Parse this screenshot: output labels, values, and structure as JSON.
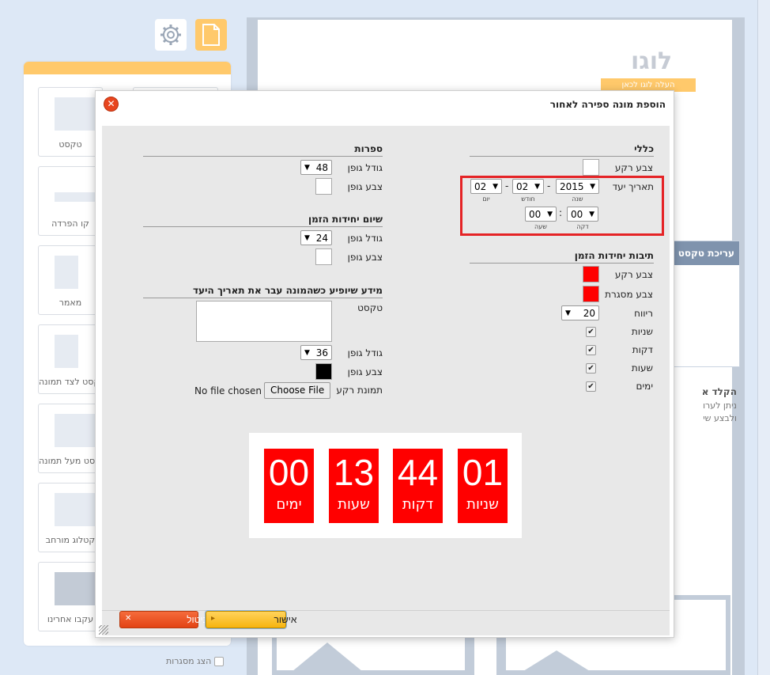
{
  "background": {
    "left_panel": {
      "widgets": [
        {
          "label": "טקסט",
          "icon": "text-widget-icon"
        },
        {
          "label": "קו הפרדה",
          "icon": "divider-widget-icon"
        },
        {
          "label": "מאמר",
          "icon": "article-widget-icon"
        },
        {
          "label": "טקסט לצד תמונה",
          "icon": "text-beside-image-icon"
        },
        {
          "label": "טקסט מעל תמונה",
          "icon": "text-above-image-icon"
        },
        {
          "label": "קטלוג מורחב",
          "icon": "catalog-icon"
        },
        {
          "label": "עקבו אחרינו",
          "icon": "social-icon"
        }
      ],
      "show_frames": "הצג מסגרות"
    },
    "canvas": {
      "logo": "לוגו",
      "logo_upload": "העלה לוגו לכאן",
      "text_edit_panel_title": "עריכת טקסט",
      "help_title": "הקלד א",
      "help_text_1": "ניתן לערו",
      "help_text_2": "ולבצע שי"
    }
  },
  "dialog": {
    "title": "הוספת מונה ספירה לאחור",
    "general": {
      "title": "כללי",
      "bg_color_label": "צבע רקע",
      "bg_color": "#ffffff",
      "target_date_label": "תאריך יעד",
      "year": {
        "value": "2015",
        "label": "שנה"
      },
      "month": {
        "value": "02",
        "label": "חודש"
      },
      "day": {
        "value": "02",
        "label": "יום"
      },
      "minute": {
        "value": "00",
        "label": "דקה"
      },
      "hour": {
        "value": "00",
        "label": "שעה"
      },
      "date_sep": "-",
      "time_sep": ":"
    },
    "unit_boxes": {
      "title": "תיבות יחידות הזמן",
      "bg_color_label": "צבע רקע",
      "bg_color": "#ff0000",
      "border_color_label": "צבע מסגרת",
      "border_color": "#ff0000",
      "spacing_label": "ריווח",
      "spacing_value": "20",
      "checkboxes": [
        {
          "label": "שניות",
          "checked": true
        },
        {
          "label": "דקות",
          "checked": true
        },
        {
          "label": "שעות",
          "checked": true
        },
        {
          "label": "ימים",
          "checked": true
        }
      ]
    },
    "digits": {
      "title": "ספרות",
      "font_size_label": "גודל גופן",
      "font_size": "48",
      "font_color_label": "צבע גופן",
      "font_color": "#ffffff"
    },
    "unit_names": {
      "title": "שיום יחידות הזמן",
      "font_size_label": "גודל גופן",
      "font_size": "24",
      "font_color_label": "צבע גופן",
      "font_color": "#ffffff"
    },
    "expired": {
      "title": "מידע שיופיע כשהמונה עבר את תאריך היעד",
      "text_label": "טקסט",
      "text_value": "",
      "font_size_label": "גודל גופן",
      "font_size": "36",
      "font_color_label": "צבע גופן",
      "font_color": "#000000",
      "bg_image_label": "תמונת רקע",
      "file_button": "Choose File",
      "file_status": "No file chosen"
    },
    "preview": {
      "box_color": "#ff0000",
      "boxes": [
        {
          "number": "01",
          "unit": "שניות"
        },
        {
          "number": "44",
          "unit": "דקות"
        },
        {
          "number": "13",
          "unit": "שעות"
        },
        {
          "number": "00",
          "unit": "ימים"
        }
      ]
    },
    "buttons": {
      "ok": "אישור",
      "cancel": "ביטול"
    }
  }
}
